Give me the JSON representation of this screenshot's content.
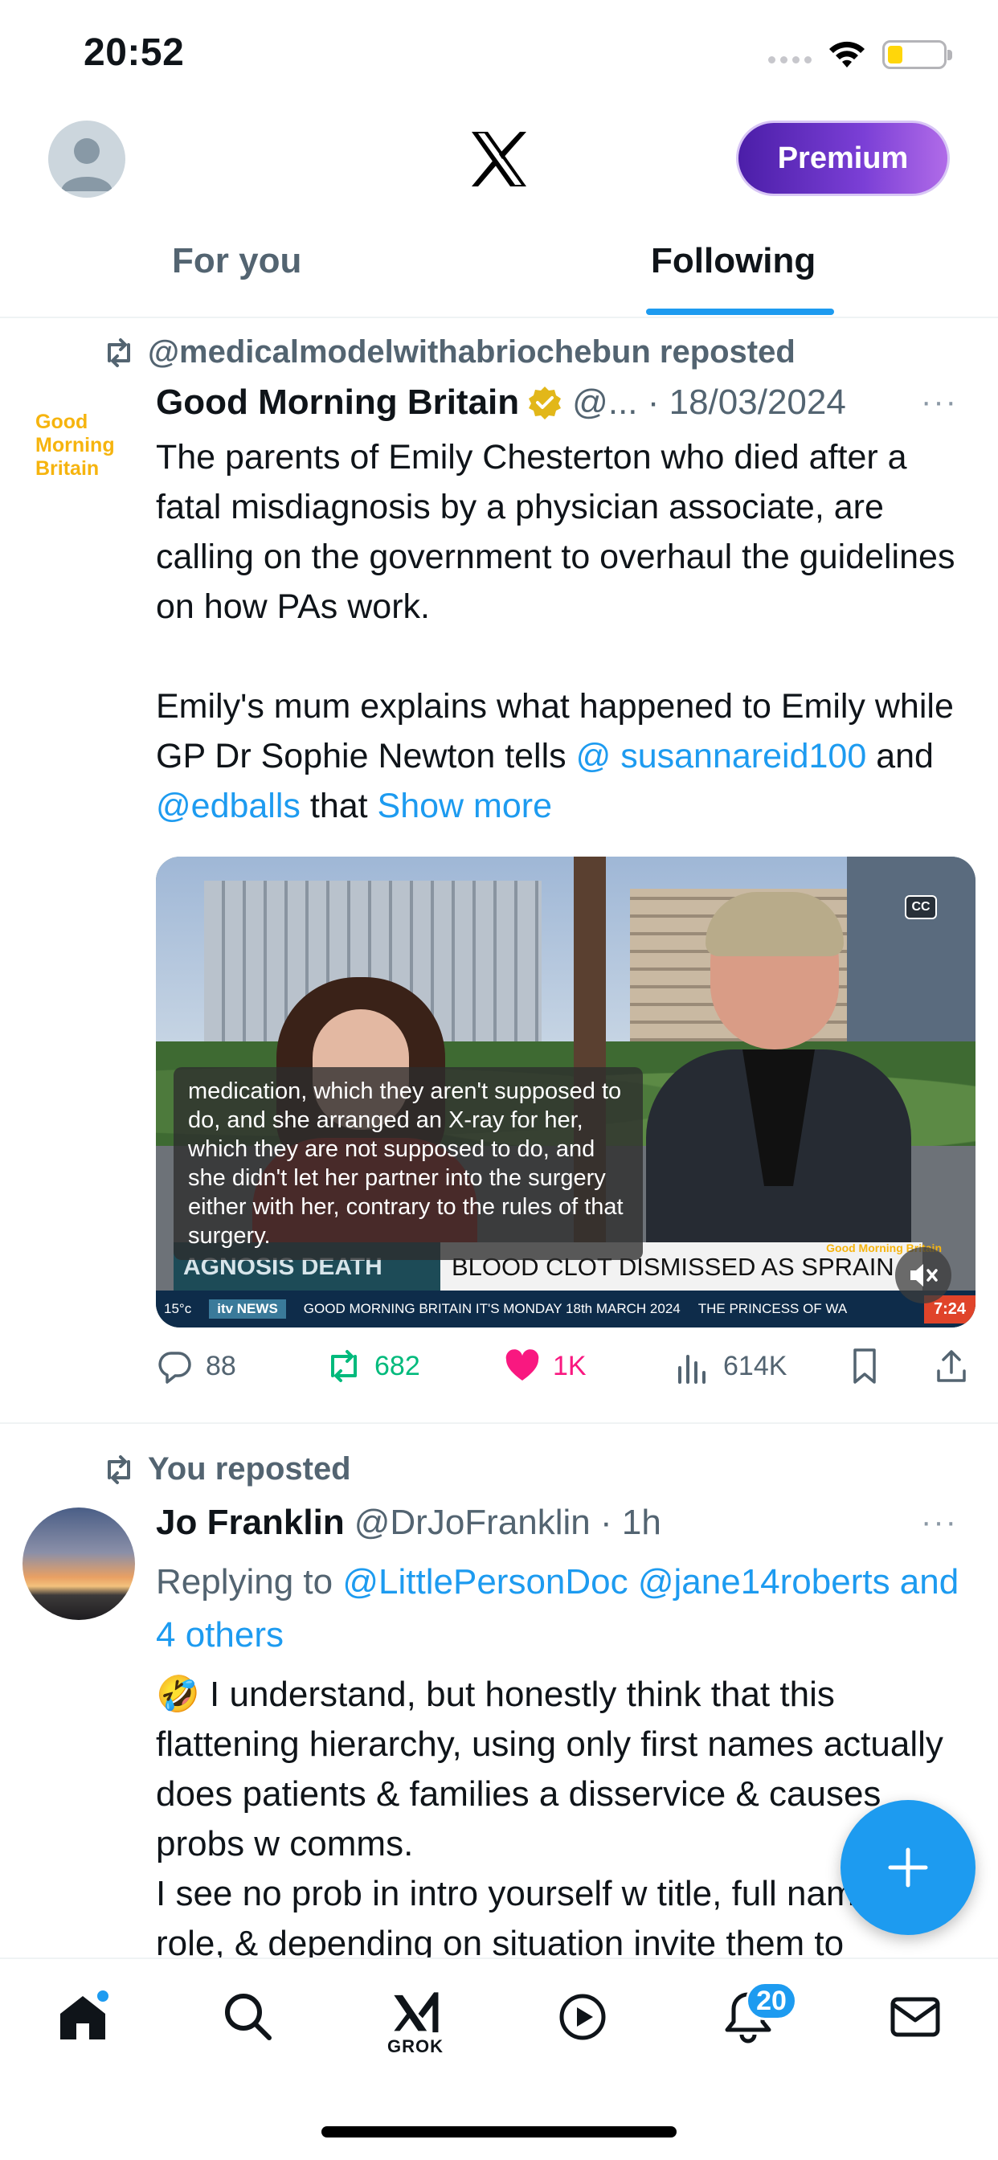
{
  "status_bar": {
    "time": "20:52"
  },
  "header": {
    "premium_label": "Premium",
    "logo": "x-logo-icon"
  },
  "tabs": [
    {
      "label": "For you",
      "active": false
    },
    {
      "label": "Following",
      "active": true
    }
  ],
  "tweet1": {
    "repost_text": "@medicalmodelwithabriochebun reposted",
    "avatar_text": [
      "Good",
      "Morning",
      "Britain"
    ],
    "name": "Good Morning Britain",
    "handle_date": "@... · 18/03/2024",
    "more": "···",
    "body_line1": "The parents of Emily Chesterton who died after a fatal misdiagnosis by a physician associate, are calling on the government to overhaul the guidelines on how PAs work.",
    "body_line2_pre": "Emily's mum explains what happened to Emily while GP Dr Sophie Newton tells ",
    "mention1": "@ susannareid100",
    "and_text": " and ",
    "mention2": "@edballs",
    "that_text": " that ",
    "show_more": "Show more",
    "video": {
      "cc": "CC",
      "caption": "medication, which they aren't supposed to do, and she arranged an X-ray for her, which they are not supposed to do, and she didn't let her partner into the surgery either with her, contrary to the rules of that surgery.",
      "lower_third_left": "AGNOSIS DEATH",
      "lower_third_right": "BLOOD CLOT DISMISSED AS SPRAIN",
      "ticker_temp": "15°c",
      "ticker_brand": "itv NEWS",
      "ticker_text": "GOOD MORNING BRITAIN IT'S MONDAY 18th MARCH 2024",
      "ticker_text2": "THE PRINCESS OF WA",
      "ticker_time": "7:24",
      "corner_logo": "Good Morning Britain"
    },
    "stats": {
      "replies": "88",
      "reposts": "682",
      "likes": "1K",
      "views": "614K"
    }
  },
  "tweet2": {
    "repost_text": "You reposted",
    "name": "Jo Franklin",
    "handle_time": "@DrJoFranklin · 1h",
    "more": "···",
    "replying_to_label": "Replying to ",
    "replying_to_handles": "@LittlePersonDoc @jane14roberts and 4 others",
    "emoji": "🤣",
    "body_p1": " I understand, but honestly think that this flattening hierarchy, using only first names actually does patients & families a disservice & causes probs w comms.",
    "body_p2": "I see no prob in intro yourself w title, full name & role, & depending on situation invite them to"
  },
  "bottom_nav": {
    "items": [
      "home-icon",
      "search-icon",
      "grok-icon",
      "video-icon",
      "notifications-icon",
      "messages-icon"
    ],
    "grok_label": "GROK",
    "notification_count": "20"
  },
  "colors": {
    "accent": "#1d9bf0",
    "repost_green": "#00ba7c",
    "like_pink": "#f91880",
    "secondary_text": "#536471"
  }
}
